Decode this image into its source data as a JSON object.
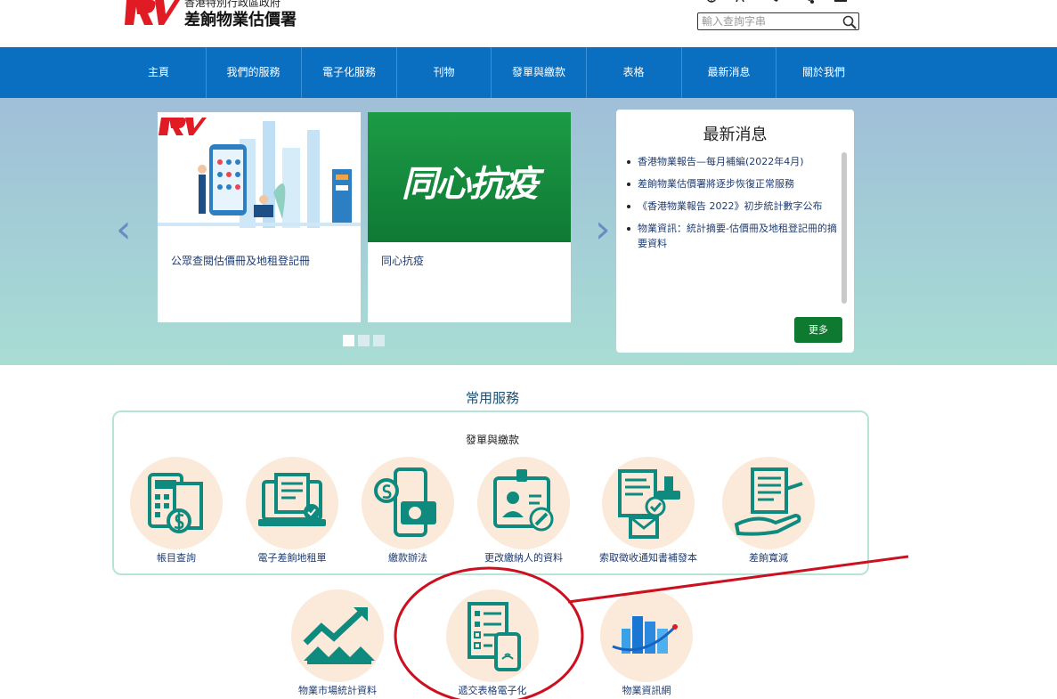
{
  "header": {
    "gov_line": "香港特別行政區政府",
    "dept_name": "差餉物業估價署",
    "logo_text": "RV",
    "search_placeholder": "輸入查詢字串",
    "utility_icons": [
      "globe-icon",
      "text-size-icon",
      "phone-icon",
      "share-icon",
      "print-icon"
    ]
  },
  "nav": {
    "items": [
      "主頁",
      "我們的服務",
      "電子化服務",
      "刊物",
      "發單與繳款",
      "表格",
      "最新消息",
      "關於我們"
    ]
  },
  "banner": {
    "slides": [
      {
        "caption": "公眾查閱估價冊及地租登記冊"
      },
      {
        "caption": "同心抗疫",
        "image_text": "同心抗疫"
      }
    ],
    "prev_arrow": "‹",
    "next_arrow": "›",
    "dots": 3,
    "news": {
      "title": "最新消息",
      "items": [
        "香港物業報告—每月補編(2022年4月)",
        "差餉物業估價署將逐步恢復正常服務",
        "《香港物業報告 2022》初步統計數字公布",
        "物業資訊：統計摘要-估價冊及地租登記冊的摘要資料"
      ],
      "more_label": "更多"
    }
  },
  "services": {
    "title": "常用服務",
    "group_title": "發單與繳款",
    "group_items": [
      {
        "label": "帳目查詢",
        "icon": "calculator-bill-icon"
      },
      {
        "label": "電子差餉地租單",
        "icon": "laptop-bill-icon"
      },
      {
        "label": "繳款辦法",
        "icon": "mobile-wallet-icon"
      },
      {
        "label": "更改繳納人的資料",
        "icon": "id-card-edit-icon"
      },
      {
        "label": "索取徵收通知書補發本",
        "icon": "document-stamp-icon"
      },
      {
        "label": "差餉寬減",
        "icon": "hand-document-icon"
      }
    ],
    "other_items": [
      {
        "label": "物業市場統計資料",
        "icon": "house-chart-icon"
      },
      {
        "label": "遞交表格電子化",
        "icon": "eform-mobile-icon"
      },
      {
        "label": "物業資訊網",
        "icon": "buildings-icon"
      }
    ]
  },
  "colors": {
    "nav_bg": "#0a6fc0",
    "accent_teal": "#0f8a7e",
    "brand_red": "#e01b23",
    "more_button": "#0e7a2f",
    "annotation_red": "#cc1020"
  }
}
